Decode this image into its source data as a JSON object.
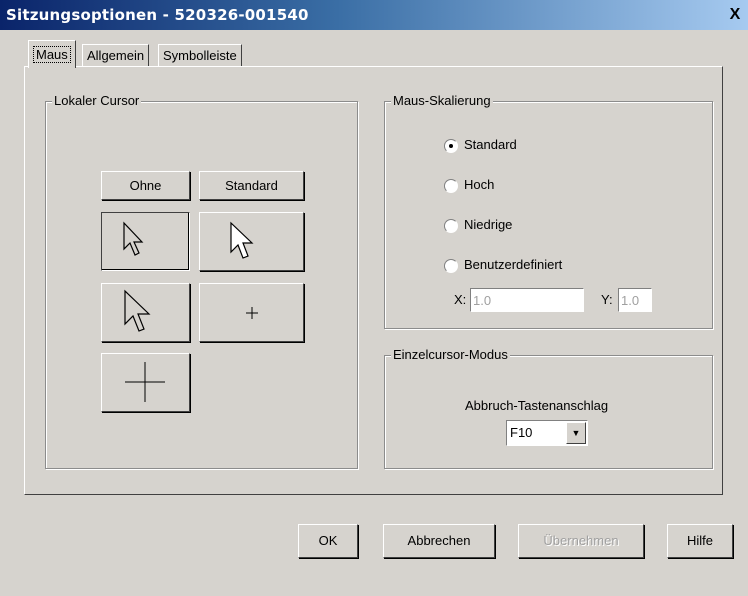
{
  "window": {
    "title": "Sitzungsoptionen - 520326-001540",
    "close_label": "X"
  },
  "tabs": [
    {
      "label": "Maus",
      "active": true
    },
    {
      "label": "Allgemein",
      "active": false
    },
    {
      "label": "Symbolleiste",
      "active": false
    }
  ],
  "local_cursor": {
    "legend": "Lokaler Cursor",
    "none_button": "Ohne",
    "default_button": "Standard",
    "cursor_options": [
      "small-arrow-cursor-icon",
      "large-arrow-cursor-icon",
      "outline-arrow-cursor-icon",
      "small-crosshair-icon",
      "large-crosshair-icon"
    ],
    "selected_option": "small-arrow-cursor-icon"
  },
  "mouse_scaling": {
    "legend": "Maus-Skalierung",
    "options": [
      {
        "label": "Standard",
        "checked": true
      },
      {
        "label": "Hoch",
        "checked": false
      },
      {
        "label": "Niedrige",
        "checked": false
      },
      {
        "label": "Benutzerdefiniert",
        "checked": false
      }
    ],
    "x_label": "X:",
    "x_value": "1.0",
    "y_label": "Y:",
    "y_value": "1.0"
  },
  "single_cursor": {
    "legend": "Einzelcursor-Modus",
    "key_label": "Abbruch-Tastenanschlag",
    "key_value": "F10"
  },
  "buttons": {
    "ok": "OK",
    "cancel": "Abbrechen",
    "apply": "Übernehmen",
    "help": "Hilfe"
  },
  "colors": {
    "titlebar_start": "#0a246a",
    "titlebar_end": "#a6caf0",
    "dialog_bg": "#d6d3ce"
  }
}
